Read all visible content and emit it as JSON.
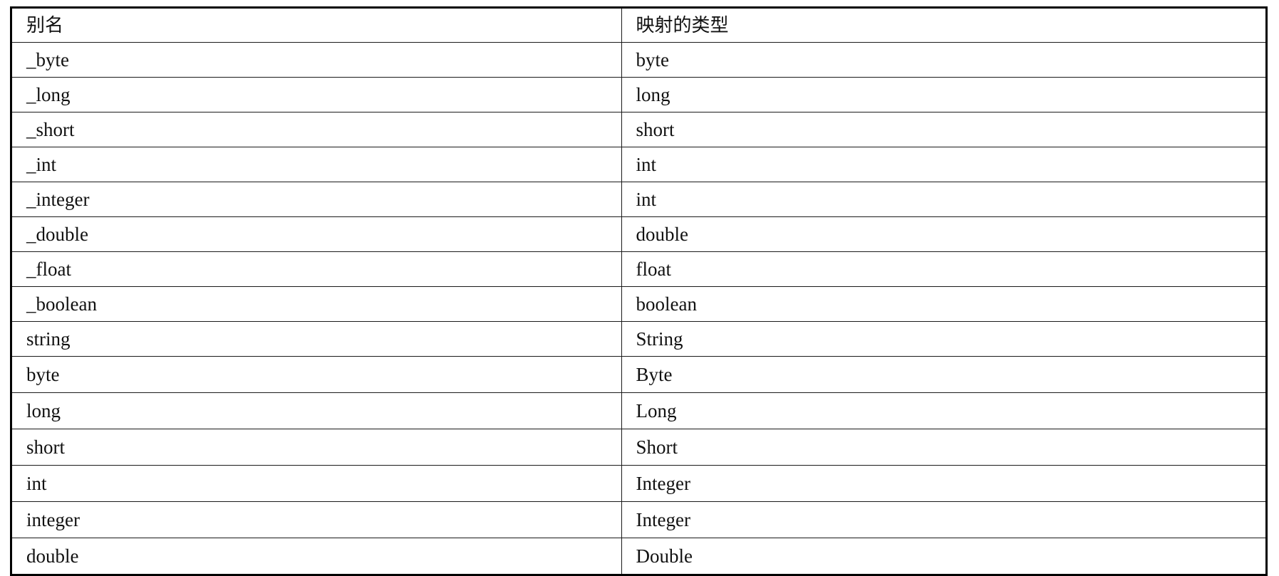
{
  "table": {
    "headers": [
      "别名",
      "映射的类型"
    ],
    "rows": [
      [
        "_byte",
        "byte"
      ],
      [
        "_long",
        "long"
      ],
      [
        "_short",
        "short"
      ],
      [
        "_int",
        "int"
      ],
      [
        "_integer",
        "int"
      ],
      [
        "_double",
        "double"
      ],
      [
        "_float",
        "float"
      ],
      [
        "_boolean",
        "boolean"
      ],
      [
        "string",
        "String"
      ],
      [
        "byte",
        "Byte"
      ],
      [
        "long",
        "Long"
      ],
      [
        "short",
        "Short"
      ],
      [
        "int",
        "Integer"
      ],
      [
        "integer",
        "Integer"
      ],
      [
        "double",
        "Double"
      ]
    ]
  }
}
